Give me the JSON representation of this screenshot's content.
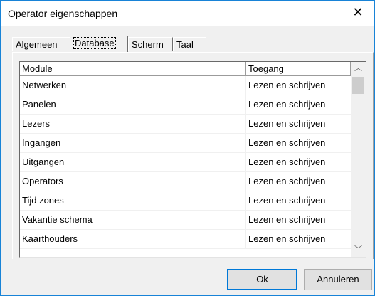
{
  "window": {
    "title": "Operator eigenschappen",
    "close_glyph": "✕"
  },
  "tabs": [
    {
      "label": "Algemeen",
      "active": false
    },
    {
      "label": "Database",
      "active": true
    },
    {
      "label": "Scherm",
      "active": false
    },
    {
      "label": "Taal",
      "active": false
    }
  ],
  "grid": {
    "columns": [
      "Module",
      "Toegang"
    ],
    "rows": [
      [
        "Netwerken",
        "Lezen en schrijven"
      ],
      [
        "Panelen",
        "Lezen en schrijven"
      ],
      [
        "Lezers",
        "Lezen en schrijven"
      ],
      [
        "Ingangen",
        "Lezen en schrijven"
      ],
      [
        "Uitgangen",
        "Lezen en schrijven"
      ],
      [
        "Operators",
        "Lezen en schrijven"
      ],
      [
        "Tijd zones",
        "Lezen en schrijven"
      ],
      [
        "Vakantie schema",
        "Lezen en schrijven"
      ],
      [
        "Kaarthouders",
        "Lezen en schrijven"
      ]
    ],
    "scroll_up_glyph": "︿",
    "scroll_down_glyph": "﹀"
  },
  "buttons": {
    "ok": "Ok",
    "cancel": "Annuleren"
  },
  "colors": {
    "accent": "#0078d7",
    "window_border": "#1883d7",
    "face": "#f0f0f0"
  }
}
